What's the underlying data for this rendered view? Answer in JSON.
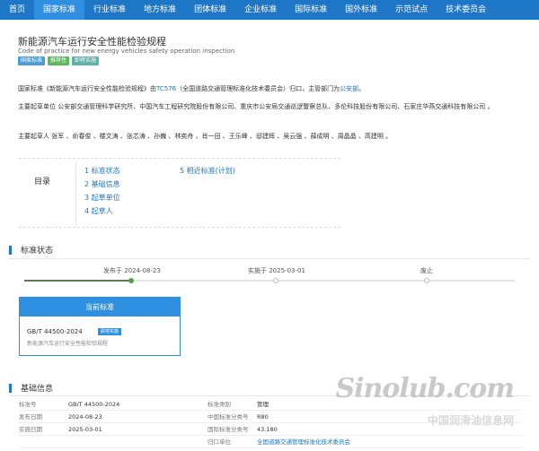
{
  "nav": {
    "items": [
      "首页",
      "国家标准",
      "行业标准",
      "地方标准",
      "团体标准",
      "企业标准",
      "国际标准",
      "国外标准",
      "示范试点",
      "技术委员会"
    ],
    "active_index": 1
  },
  "standard": {
    "title": "新能源汽车运行安全性能检验规程",
    "subtitle": "Code of practice for new energy vehicles safety operation inspection",
    "tags": [
      {
        "label": "国家标准",
        "color": "#4a9bd8"
      },
      {
        "label": "推荐性",
        "color": "#5cb85c"
      },
      {
        "label": "即将实施",
        "color": "#5fb0a8"
      }
    ]
  },
  "description": {
    "line1_a": "国家标准《新能源汽车运行安全性能检验规程》由",
    "line1_tc": "TC576",
    "line1_b": "（全国道路交通管理标准化技术委员会）归口，主管部门为",
    "line1_dept": "公安部",
    "line1_c": "。",
    "drafting_units": "主要起草单位 公安部交通管理科学研究所、中国汽车工程研究院股份有限公司、重庆市公安局交通巡逻警察总队、多伦科技股份有限公司、石家庄华燕交通科技有限公司 。",
    "drafters": "主要起草人 张军 、俞春俊 、楼文涛 、张芯涛 、孙巍 、林奕舟 、肖一田 、王乐峰 、邸建辉 、吴云强 、薛成明 、周晶晶 、高建明 。"
  },
  "toc": {
    "label": "目录",
    "items": [
      "1 标准状态",
      "2 基础信息",
      "3 起草单位",
      "4 起草人",
      "5 相近标准(计划)"
    ]
  },
  "status_section": {
    "heading": "标准状态",
    "timeline": [
      {
        "label": "发布于 2024-08-23",
        "done": true
      },
      {
        "label": "实施于 2025-03-01",
        "done": false
      },
      {
        "label": "废止",
        "done": false
      }
    ],
    "current": {
      "header": "当前标准",
      "code": "GB/T 44500-2024",
      "badge": "即将实施",
      "name": "新能源汽车运行安全性能检验规程"
    }
  },
  "info_section": {
    "heading": "基础信息",
    "rows": [
      {
        "k1": "标准号",
        "v1": "GB/T 44500-2024",
        "k2": "标准类别",
        "v2": "管理",
        "link": false
      },
      {
        "k1": "发布日期",
        "v1": "2024-08-23",
        "k2": "中国标准分类号",
        "v2": "R80",
        "link": false
      },
      {
        "k1": "实施日期",
        "v1": "2025-03-01",
        "k2": "国际标准分类号",
        "v2": "43.180",
        "link": false
      },
      {
        "k1": "",
        "v1": "",
        "k2": "归口单位",
        "v2": "全国道路交通管理标准化技术委员会",
        "link": true
      }
    ]
  },
  "watermark": {
    "logo": "Sinolub.com",
    "cn": "中国润滑油信息网"
  }
}
